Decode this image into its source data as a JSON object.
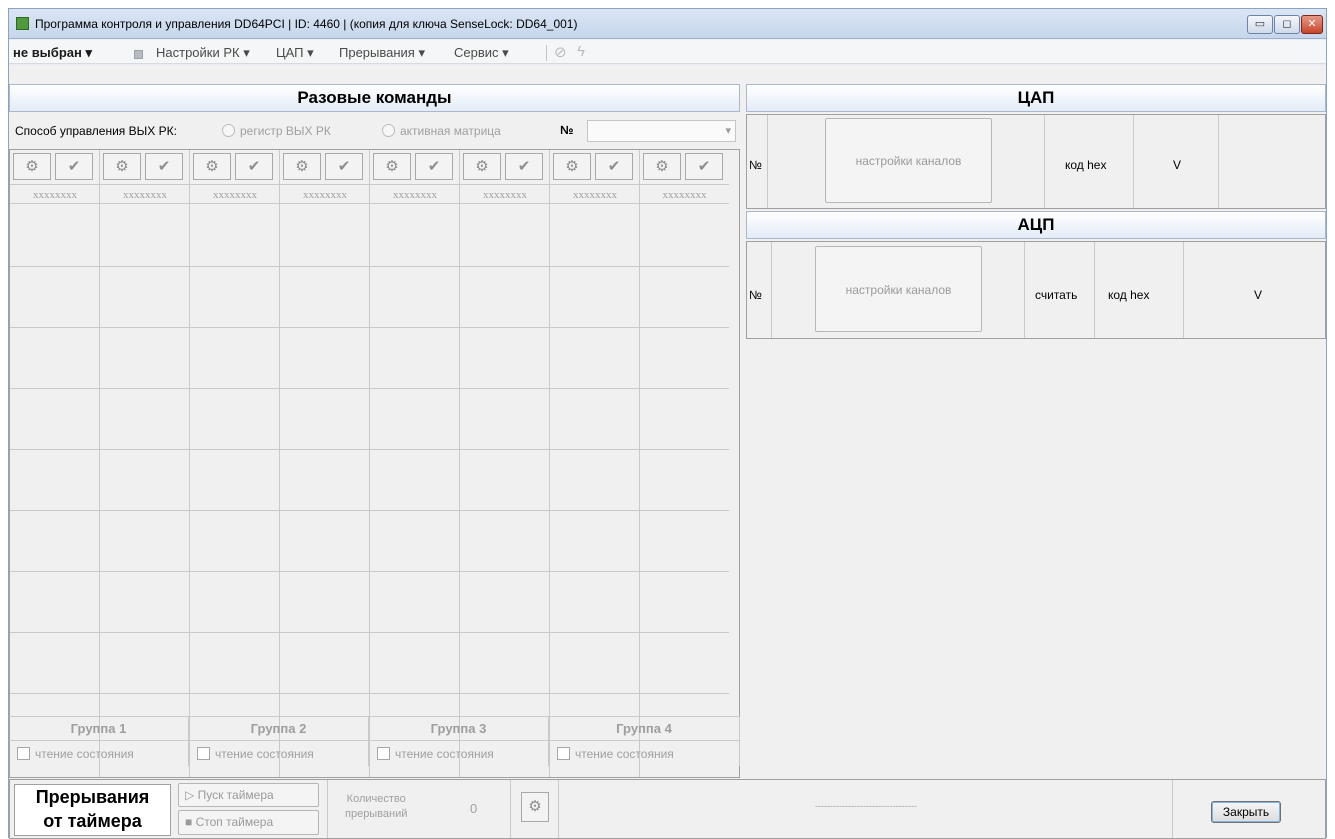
{
  "window": {
    "title": "Программа контроля и управления DD64PCI | ID: 4460 | (копия для ключа SenseLock: DD64_001)",
    "controls": {
      "minimize": "▭",
      "maximize": "◻",
      "close": "✕"
    }
  },
  "menubar": {
    "device_select": "не выбран",
    "items": [
      "Настройки РК",
      "ЦАП",
      "Прерывания",
      "Сервис"
    ]
  },
  "one_time": {
    "title": "Разовые команды",
    "mode_label": "Способ управления ВЫХ РК:",
    "radio_register": "регистр ВЫХ РК",
    "radio_matrix": "активная матрица",
    "number_label": "№",
    "columns": [
      {
        "code": "xxxxxxxx"
      },
      {
        "code": "xxxxxxxx"
      },
      {
        "code": "xxxxxxxx"
      },
      {
        "code": "xxxxxxxx"
      },
      {
        "code": "xxxxxxxx"
      },
      {
        "code": "xxxxxxxx"
      },
      {
        "code": "xxxxxxxx"
      },
      {
        "code": "xxxxxxxx"
      }
    ],
    "groups": [
      {
        "name": "Группа 1",
        "read_state": "чтение состояния"
      },
      {
        "name": "Группа 2",
        "read_state": "чтение состояния"
      },
      {
        "name": "Группа 3",
        "read_state": "чтение состояния"
      },
      {
        "name": "Группа 4",
        "read_state": "чтение состояния"
      }
    ]
  },
  "dac": {
    "title": "ЦАП",
    "col_number": "№",
    "channel_settings": "настройки каналов",
    "col_hex": "код hex",
    "col_v": "V"
  },
  "adc": {
    "title": "АЦП",
    "col_number": "№",
    "channel_settings": "настройки каналов",
    "col_read": "считать",
    "col_hex": "код hex",
    "col_v": "V"
  },
  "timer": {
    "label_line1": "Прерывания",
    "label_line2": "от таймера",
    "start_button": "Пуск таймера",
    "stop_button": "Стоп таймера",
    "count_line1": "Количество",
    "count_line2": "прерываний",
    "count_value": "0",
    "status_text": "----------------------------------",
    "close_button": "Закрыть"
  }
}
